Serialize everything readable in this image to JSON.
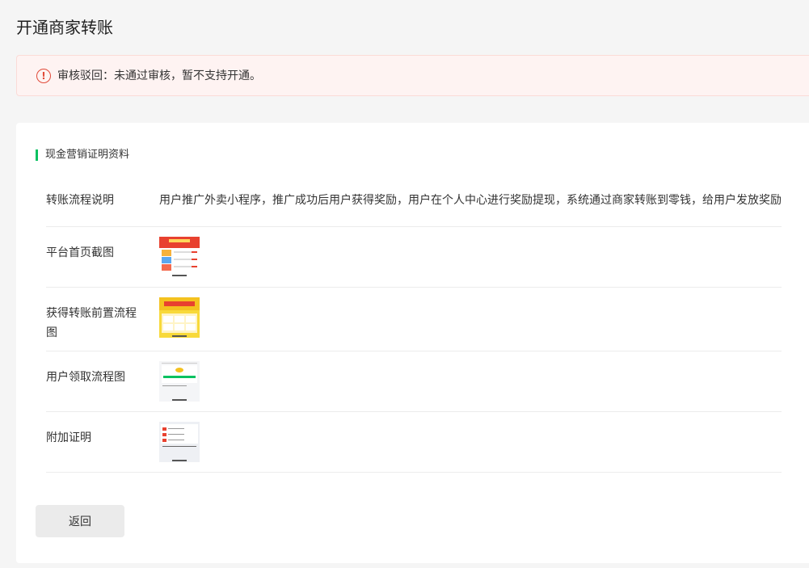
{
  "page": {
    "title": "开通商家转账"
  },
  "alert": {
    "icon": "alert-circle-icon",
    "text": "审核驳回：未通过审核，暂不支持开通。"
  },
  "section": {
    "title": "现金营销证明资料",
    "rows": [
      {
        "label": "转账流程说明",
        "value": "用户推广外卖小程序，推广成功后用户获得奖励，用户在个人中心进行奖励提现，系统通过商家转账到零钱，给用户发放奖励"
      },
      {
        "label": "平台首页截图",
        "image": "platform-homepage-screenshot"
      },
      {
        "label": "获得转账前置流程图",
        "image": "pre-transfer-flow-screenshot"
      },
      {
        "label": "用户领取流程图",
        "image": "user-claim-flow-screenshot"
      },
      {
        "label": "附加证明",
        "image": "additional-proof-screenshot"
      }
    ]
  },
  "actions": {
    "back_label": "返回"
  },
  "colors": {
    "accent": "#07c160",
    "alert_red": "#e14a39",
    "alert_bg": "#fef3f2"
  }
}
